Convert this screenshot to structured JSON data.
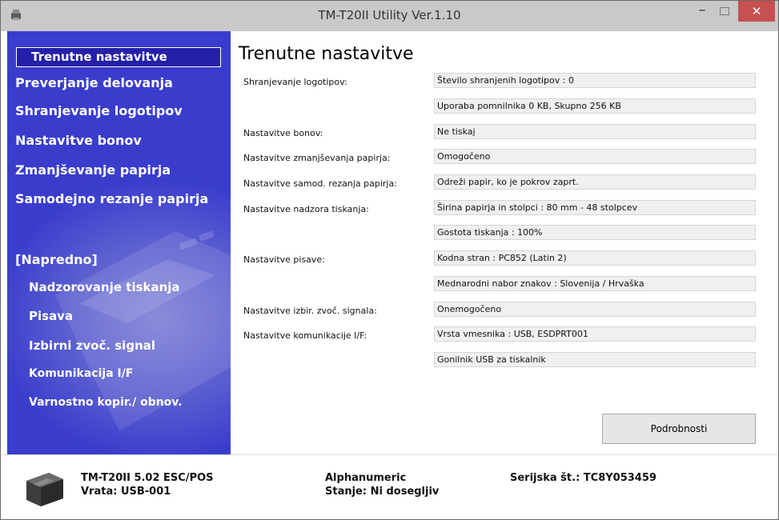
{
  "window": {
    "title": "TM-T20II Utility Ver.1.10",
    "minimize_label": "–",
    "close_label": "✕"
  },
  "sidebar": {
    "active": "Trenutne nastavitve",
    "items": [
      "Preverjanje delovanja",
      "Shranjevanje logotipov",
      "Nastavitve bonov",
      "Zmanjševanje papirja",
      "Samodejno rezanje papirja"
    ],
    "advanced_header": "[Napredno]",
    "advanced_items": [
      "Nadzorovanje tiskanja",
      "Pisava",
      "Izbirni zvoč. signal",
      "Komunikacija I/F",
      "Varnostno kopir./ obnov."
    ]
  },
  "main": {
    "title": "Trenutne nastavitve",
    "rows": [
      {
        "label": "Shranjevanje logotipov:",
        "value": "Število shranjenih logotipov : 0"
      },
      {
        "label": "",
        "value": "Uporaba pomnilnika 0 KB, Skupno 256 KB"
      },
      {
        "label": "Nastavitve bonov:",
        "value": "Ne tiskaj"
      },
      {
        "label": "Nastavitve zmanjševanja papirja:",
        "value": "Omogočeno"
      },
      {
        "label": "Nastavitve samod. rezanja papirja:",
        "value": "Odreži papir, ko je pokrov zaprt."
      },
      {
        "label": "Nastavitve nadzora tiskanja:",
        "value": "Širina papirja in stolpci : 80 mm - 48 stolpcev"
      },
      {
        "label": "",
        "value": "Gostota tiskanja : 100%"
      },
      {
        "label": "Nastavitve pisave:",
        "value": "Kodna stran : PC852 (Latin 2)"
      },
      {
        "label": "",
        "value": "Mednarodni nabor znakov : Slovenija / Hrvaška"
      },
      {
        "label": "Nastavitve izbir. zvoč. signala:",
        "value": "Onemogočeno"
      },
      {
        "label": "Nastavitve komunikacije I/F:",
        "value": "Vrsta vmesnika : USB, ESDPRT001"
      },
      {
        "label": "",
        "value": "Gonilnik USB za tiskalnik"
      }
    ],
    "details_button": "Podrobnosti"
  },
  "footer": {
    "model": "TM-T20II 5.02 ESC/POS",
    "port": "Vrata: USB-001",
    "mode": "Alphanumeric",
    "status": "Stanje: Ni dosegljiv",
    "serial": "Serijska št.: TC8Y053459"
  },
  "colors": {
    "sidebar": "#3a3ccb",
    "active_item": "#2420a8",
    "close_button": "#c75050",
    "titlebar": "#c9c9c9"
  },
  "icons": {
    "app": "printer-app-icon",
    "printer": "printer-device-icon"
  }
}
